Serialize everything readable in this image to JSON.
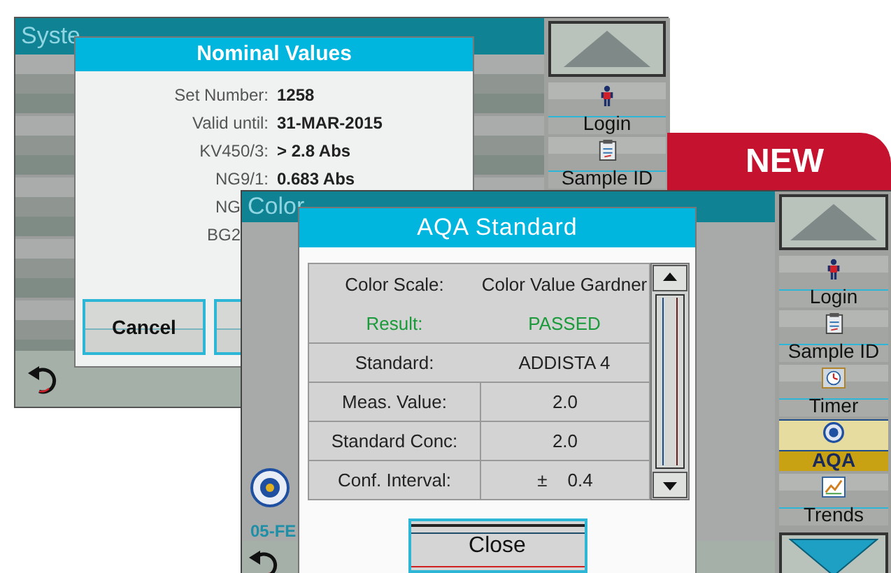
{
  "system_checks_screen": {
    "title": "Syste",
    "sidebar": {
      "items": [
        {
          "label": "Login",
          "kind": "person",
          "selected": false
        },
        {
          "label": "Sample ID",
          "kind": "clipboard",
          "selected": false
        }
      ]
    },
    "dialog": {
      "title": "Nominal Values",
      "rows": [
        {
          "label": "Set Number:",
          "value": "1258"
        },
        {
          "label": "Valid until:",
          "value": "31-MAR-2015"
        },
        {
          "label": "KV450/3:",
          "value": "> 2.8 Abs"
        },
        {
          "label": "NG9/1:",
          "value": "0.683 Abs"
        },
        {
          "label": "NG"
        },
        {
          "label": "BG2"
        }
      ],
      "buttons": [
        {
          "label": "Cancel"
        }
      ]
    }
  },
  "new_badge": {
    "label": "NEW"
  },
  "color_measurement_screen": {
    "title": "Color",
    "date": "05-FE",
    "sidebar": {
      "items": [
        {
          "label": "Login",
          "kind": "person",
          "selected": false
        },
        {
          "label": "Sample ID",
          "kind": "clipboard",
          "selected": false
        },
        {
          "label": "Timer",
          "kind": "timer",
          "selected": false
        },
        {
          "label": "AQA",
          "kind": "aqa",
          "selected": true
        },
        {
          "label": "Trends",
          "kind": "trends",
          "selected": false
        }
      ]
    },
    "dialog": {
      "title": "AQA Standard",
      "rows": [
        {
          "label": "Color Scale:",
          "value": "Color Value Gardner"
        },
        {
          "label": "Result:",
          "value": "PASSED",
          "color": "#1a9a3a"
        },
        {
          "label": "Standard:",
          "value": "ADDISTA 4"
        },
        {
          "label": "Meas. Value:",
          "value": "2.0"
        },
        {
          "label": "Standard Conc:",
          "value": "2.0"
        },
        {
          "label": "Conf. Interval:",
          "value": "±    0.4"
        }
      ],
      "button": "Close"
    }
  }
}
